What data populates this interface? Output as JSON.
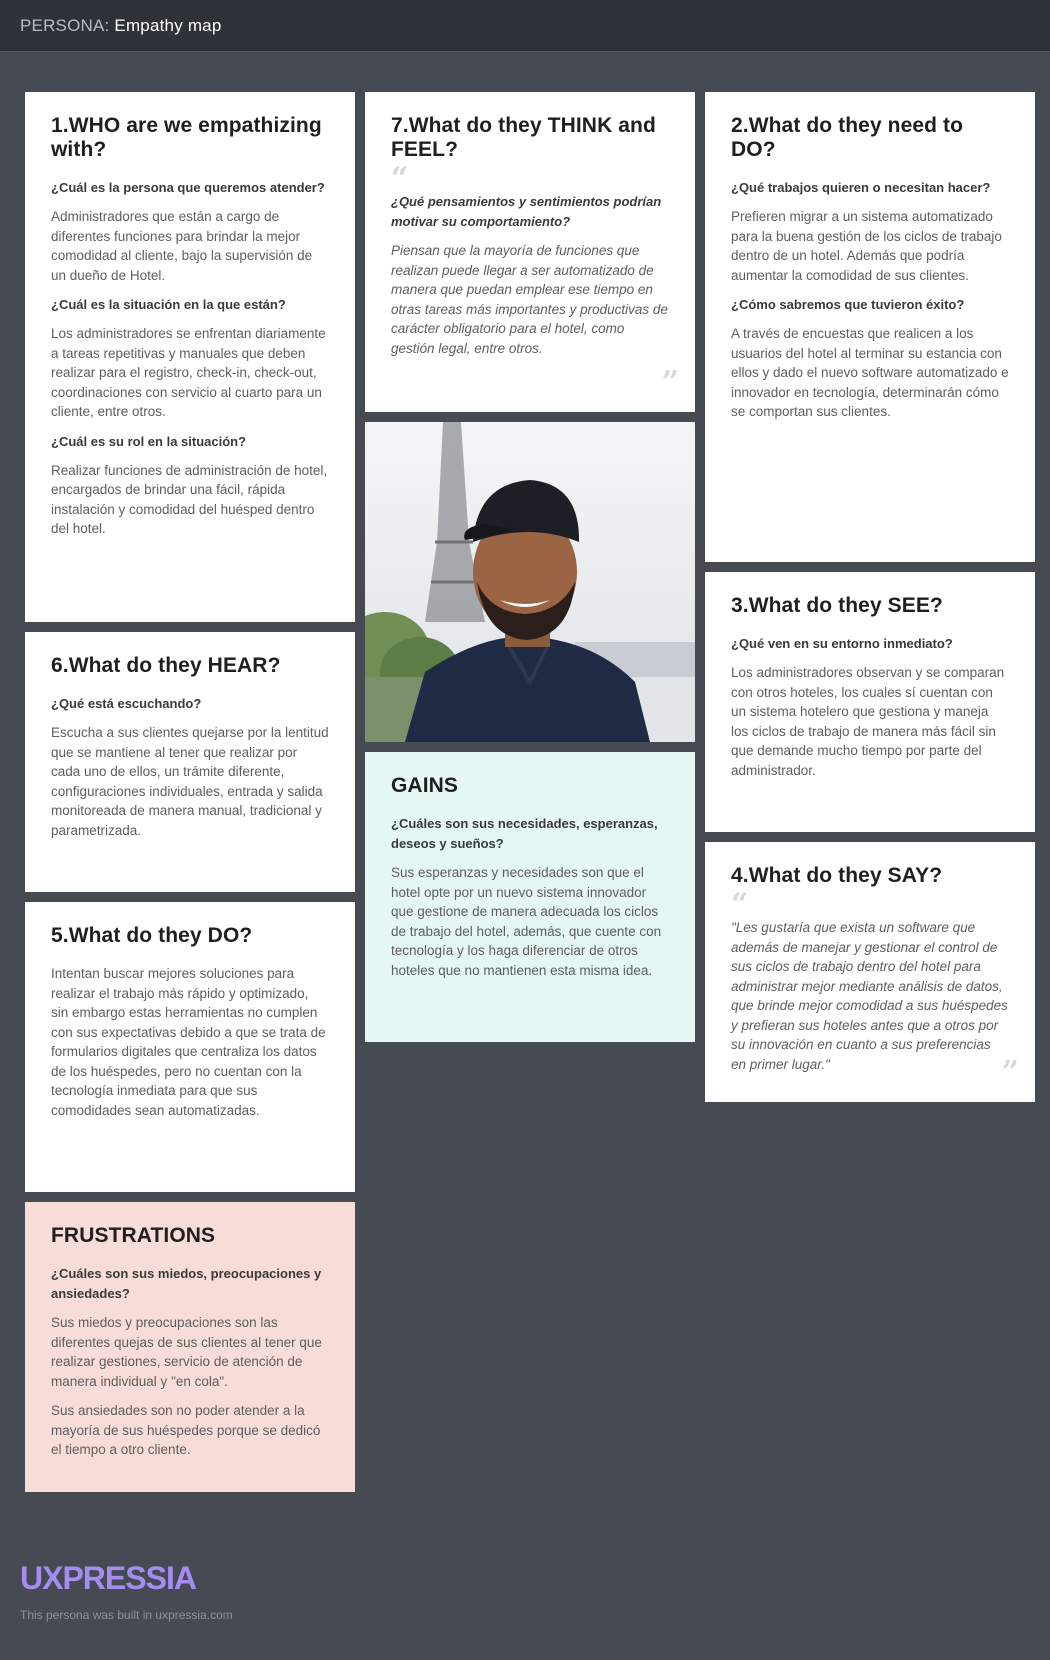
{
  "header": {
    "prefix": "PERSONA:",
    "title": "Empathy map"
  },
  "cards": {
    "who": {
      "title": "1.WHO are we empathizing with?",
      "q1": "¿Cuál es la persona que queremos atender?",
      "a1": "Administradores que están a cargo de diferentes funciones para brindar la mejor comodidad al cliente, bajo la supervisión de un dueño de Hotel.",
      "q2": "¿Cuál es la situación en la que están?",
      "a2": "Los administradores se enfrentan diariamente a tareas repetitivas y manuales que deben realizar para el registro, check-in, check-out, coordinaciones con servicio al cuarto para un cliente, entre otros.",
      "q3": "¿Cuál es su rol en la situación?",
      "a3": "Realizar funciones de administración de hotel, encargados de brindar una fácil, rápida instalación y comodidad del huésped dentro del hotel."
    },
    "hear": {
      "title": "6.What do they HEAR?",
      "q1": "¿Qué está escuchando?",
      "a1": "Escucha a sus clientes quejarse por la lentitud que se mantiene al tener que realizar por cada uno de ellos, un trámite diferente, configuraciones individuales, entrada y salida monitoreada de manera manual, tradicional y parametrizada."
    },
    "do": {
      "title": "5.What do they DO?",
      "a1": "Intentan buscar mejores soluciones para realizar el trabajo más rápido y optimizado, sin embargo estas herramientas no cumplen con sus expectativas debido a que se trata de formularios digitales que centraliza los datos de los huéspedes, pero no cuentan con la tecnología inmediata para que sus comodidades sean automatizadas."
    },
    "frustrations": {
      "title": "FRUSTRATIONS",
      "q1": "¿Cuáles son sus miedos, preocupaciones y ansiedades?",
      "a1": "Sus miedos y preocupaciones son las diferentes quejas de sus clientes al tener que realizar gestiones, servicio de atención de manera individual y \"en cola\".",
      "a2": "Sus ansiedades son no poder atender a la mayoría de sus huéspedes porque se dedicó el tiempo a otro cliente."
    },
    "think": {
      "title": "7.What do they THINK and FEEL?",
      "q1": "¿Qué pensamientos y sentimientos podrían motivar su comportamiento?",
      "a1": "Piensan que la mayoría de funciones que realizan puede llegar a ser automatizado de manera que puedan emplear ese tiempo en otras tareas más importantes y productivas de carácter obligatorio para el hotel, como gestión legal, entre otros."
    },
    "gains": {
      "title": "GAINS",
      "q1": "¿Cuáles son sus necesidades, esperanzas, deseos y sueños?",
      "a1": "Sus esperanzas y necesidades son que el hotel opte por un nuevo sistema innovador que gestione de manera adecuada los ciclos de trabajo del hotel, además, que cuente con tecnología y los haga diferenciar de otros hoteles que no mantienen esta misma idea."
    },
    "need": {
      "title": "2.What do they need to DO?",
      "q1": "¿Qué trabajos quieren o necesitan hacer?",
      "a1": "Prefieren migrar a un sistema automatizado para la buena gestión de los ciclos de trabajo dentro de un hotel. Además que podría aumentar la comodidad de sus clientes.",
      "q2": "¿Cómo sabremos que tuvieron éxito?",
      "a2": "A través de encuestas que realicen a los usuarios del hotel al terminar su estancia con ellos y dado el nuevo software automatizado e innovador en tecnología, determinarán cómo se comportan sus clientes."
    },
    "see": {
      "title": "3.What do they SEE?",
      "q1": "¿Qué ven en su entorno inmediato?",
      "a1": "Los administradores observan y se comparan con otros hoteles, los cuales sí cuentan con un sistema hotelero que gestiona y maneja los ciclos de trabajo de manera más fácil sin que demande mucho tiempo por parte del administrador."
    },
    "say": {
      "title": "4.What do they SAY?",
      "a1": "\"Les gustaría que exista un software que además de manejar y gestionar el control de sus ciclos de trabajo dentro del hotel para administrar mejor mediante análisis de datos, que brinde mejor comodidad a sus huéspedes y prefieran sus hoteles antes que a otros por su innovación en cuanto a sus preferencias en primer lugar.\""
    }
  },
  "quote_marks": {
    "open": "“",
    "close": "”"
  },
  "footer": {
    "logo": "UXPRESSIA",
    "note": "This persona was built in uxpressia.com"
  },
  "colors": {
    "background": "#464a52",
    "topbar": "#2e3239",
    "gains": "#e5f7f3",
    "frustrations": "#f8dcd8",
    "logo": "#a58cf0"
  }
}
